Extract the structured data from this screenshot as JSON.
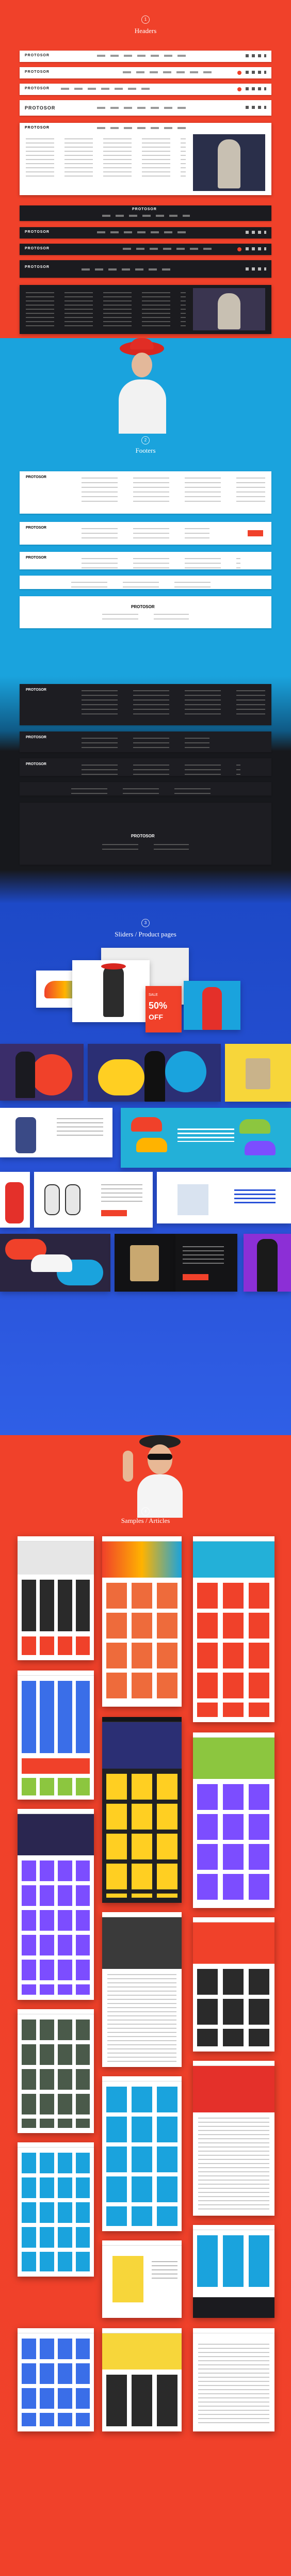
{
  "sections": {
    "headers": {
      "number": "1",
      "title": "Headers",
      "bg": "#f0412a"
    },
    "footers": {
      "number": "2",
      "title": "Footers",
      "bg": "#1aa3dd"
    },
    "sliders": {
      "number": "3",
      "title": "Sliders / Product pages",
      "bg": "#2a4fd8"
    },
    "samples": {
      "number": "4",
      "title": "Samples / Articles",
      "bg": "#f0412a"
    }
  },
  "brand": {
    "logo": "PROTOSOR"
  },
  "header_variants": [
    "light",
    "light",
    "light",
    "light",
    "light-mega",
    "dark",
    "dark",
    "dark",
    "dark",
    "dark-mega"
  ],
  "footer_variants": [
    "light-large",
    "light",
    "light",
    "light",
    "light-centered",
    "dark-large",
    "dark",
    "dark",
    "dark",
    "dark-centered"
  ],
  "slider_promo": {
    "sale_line": "SALE",
    "discount": "50%",
    "off": "OFF"
  },
  "colors": {
    "accent": "#f0412a",
    "blue": "#1aa3dd",
    "royal": "#2a4fd8",
    "dark": "#1b1b1f"
  }
}
